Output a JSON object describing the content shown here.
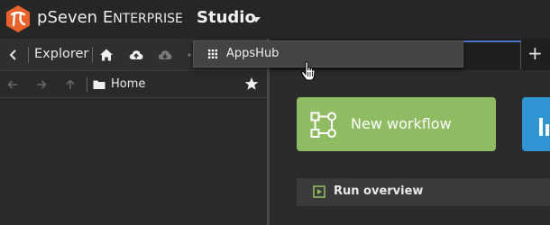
{
  "header": {
    "brand_p": "p",
    "brand_seven": "Seven",
    "brand_enterprise_e": "E",
    "brand_enterprise_rest": "NTERPRISE",
    "studio_label": "Studio",
    "logo_icon": "pseven-logo-icon",
    "studio_caret_icon": "caret-down-icon"
  },
  "explorer": {
    "title": "Explorer",
    "toolbar_icons": [
      "chevron-left-icon",
      "home-icon",
      "cloud-upload-icon",
      "cloud-download-icon"
    ],
    "nav_icons": [
      "arrow-left-icon",
      "arrow-right-icon",
      "arrow-up-icon"
    ],
    "path": "Home",
    "star_icon": "star-icon"
  },
  "tabs": {
    "plus_label": "+",
    "accent_color": "#4a73c9"
  },
  "dropdown": {
    "items": [
      {
        "label": "AppsHub",
        "icon": "apps-grid-icon"
      }
    ]
  },
  "start_page": {
    "new_workflow_label": "New workflow",
    "new_workflow_color": "#8fbb63",
    "apps_card_color": "#2f96d3",
    "run_overview_label": "Run overview"
  }
}
